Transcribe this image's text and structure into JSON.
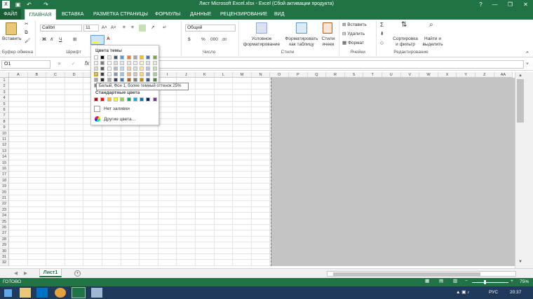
{
  "window": {
    "title": "Лист Microsoft Excel.xlsx - Excel (Сбой активации продукта)",
    "help": "?",
    "minimize": "—",
    "restore": "❐",
    "close": "✕"
  },
  "tabs": [
    "ФАЙЛ",
    "ГЛАВНАЯ",
    "ВСТАВКА",
    "РАЗМЕТКА СТРАНИЦЫ",
    "ФОРМУЛЫ",
    "ДАННЫЕ",
    "РЕЦЕНЗИРОВАНИЕ",
    "ВИД"
  ],
  "ribbon": {
    "paste": "Вставить",
    "clipboard": "Буфер обмена",
    "font": "Шрифт",
    "font_name": "Calibri",
    "font_size": "11",
    "bold": "Ж",
    "italic": "К",
    "underline": "Ч",
    "number_format": "Общий",
    "number": "Число",
    "percent": "%",
    "thousands": "000",
    "cond_format": "Условное форматирование",
    "format_table": "Форматировать как таблицу",
    "cell_styles": "Стили ячеек",
    "styles": "Стили",
    "insert": "Вставить",
    "delete": "Удалить",
    "format": "Формат",
    "cells": "Ячейки",
    "sort": "Сортировка и фильтр",
    "find": "Найти и выделить",
    "editing": "Редактирование"
  },
  "formula_bar": {
    "namebox": "O1",
    "fx": "fx"
  },
  "columns": [
    "A",
    "B",
    "C",
    "D",
    "E",
    "F",
    "G",
    "H",
    "I",
    "J",
    "K",
    "L",
    "M",
    "N",
    "O",
    "P",
    "Q",
    "R",
    "S",
    "T",
    "U",
    "V",
    "W",
    "X",
    "Y",
    "Z",
    "AA"
  ],
  "rows": [
    "1",
    "2",
    "3",
    "4",
    "5",
    "6",
    "7",
    "8",
    "9",
    "10",
    "11",
    "12",
    "13",
    "14",
    "15",
    "16",
    "17",
    "18",
    "19",
    "20",
    "21",
    "22",
    "23",
    "24",
    "25",
    "26",
    "27",
    "28",
    "29",
    "30",
    "31",
    "32"
  ],
  "dropdown": {
    "theme_colors": "Цвета темы",
    "standard_colors": "Стандартные цвета",
    "no_fill": "Нет заливки",
    "more_colors": "Другие цвета...",
    "theme_top": [
      "#ffffff",
      "#000000",
      "#e7e6e6",
      "#44546a",
      "#5b9bd5",
      "#ed7d31",
      "#a5a5a5",
      "#ffc000",
      "#4472c4",
      "#70ad47"
    ],
    "standard": [
      "#c00000",
      "#ff0000",
      "#ffc000",
      "#ffff00",
      "#92d050",
      "#00b050",
      "#00b0f0",
      "#0070c0",
      "#002060",
      "#7030a0"
    ]
  },
  "tooltip": "Белый, Фон 1, более темный оттенок 25%",
  "sheet_tab": "Лист1",
  "status": {
    "ready": "ГОТОВО",
    "zoom": "75%"
  },
  "taskbar": {
    "lang": "РУС",
    "time": "20:37"
  }
}
